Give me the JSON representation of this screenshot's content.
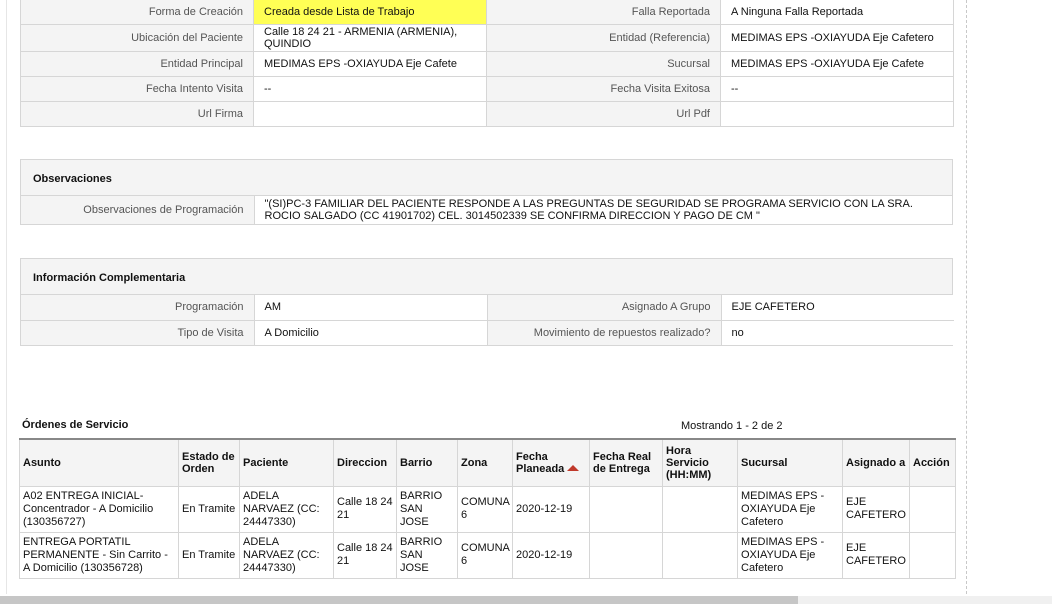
{
  "top_fields": {
    "rows": [
      {
        "l1": "Forma de Creación",
        "v1": "Creada desde Lista de Trabajo",
        "l2": "Falla Reportada",
        "v2": "A Ninguna Falla Reportada"
      },
      {
        "l1": "Ubicación del Paciente",
        "v1": "Calle 18 24 21 - ARMENIA (ARMENIA), QUINDIO",
        "l2": "Entidad (Referencia)",
        "v2": "MEDIMAS EPS -OXIAYUDA Eje Cafetero"
      },
      {
        "l1": "Entidad Principal",
        "v1": "MEDIMAS EPS -OXIAYUDA Eje Cafete",
        "l2": "Sucursal",
        "v2": "MEDIMAS EPS -OXIAYUDA Eje Cafete"
      },
      {
        "l1": "Fecha Intento Visita",
        "v1": "--",
        "l2": "Fecha Visita Exitosa",
        "v2": "--"
      },
      {
        "l1": "Url Firma",
        "v1": "",
        "l2": "Url Pdf",
        "v2": ""
      }
    ]
  },
  "observaciones": {
    "title": "Observaciones",
    "label": "Observaciones de Programación",
    "value": "\"(SI)PC-3 FAMILIAR DEL PACIENTE RESPONDE A LAS PREGUNTAS DE SEGURIDAD SE PROGRAMA SERVICIO CON LA SRA. ROCIO SALGADO (CC 41901702) CEL. 3014502339 SE CONFIRMA DIRECCION Y PAGO DE CM \""
  },
  "info_complementaria": {
    "title": "Información Complementaria",
    "rows": [
      {
        "l1": "Programación",
        "v1": "AM",
        "l2": "Asignado A Grupo",
        "v2": "EJE CAFETERO"
      },
      {
        "l1": "Tipo de Visita",
        "v1": "A Domicilio",
        "l2": "Movimiento de repuestos realizado?",
        "v2": "no"
      }
    ]
  },
  "orders": {
    "title": "Órdenes de Servicio",
    "count_text": "Mostrando 1 - 2 de 2",
    "columns": [
      "Asunto",
      "Estado de Orden",
      "Paciente",
      "Direccion",
      "Barrio",
      "Zona",
      "Fecha Planeada",
      "Fecha Real de Entrega",
      "Hora Servicio (HH:MM)",
      "Sucursal",
      "Asignado a",
      "Acción"
    ],
    "rows": [
      {
        "asunto": "A02 ENTREGA INICIAL-Concentrador - A Domicilio (130356727)",
        "estado": "En Tramite",
        "paciente": "ADELA NARVAEZ (CC: 24447330)",
        "direccion": "Calle 18 24 21",
        "barrio": "BARRIO SAN JOSE",
        "zona": "COMUNA 6",
        "fecha_planeada": "2020-12-19",
        "fecha_real": "",
        "hora": "",
        "sucursal": "MEDIMAS EPS -OXIAYUDA Eje Cafetero",
        "asignado": "EJE CAFETERO",
        "accion": ""
      },
      {
        "asunto": "ENTREGA PORTATIL PERMANENTE - Sin Carrito - A Domicilio (130356728)",
        "estado": "En Tramite",
        "paciente": "ADELA NARVAEZ (CC: 24447330)",
        "direccion": "Calle 18 24 21",
        "barrio": "BARRIO SAN JOSE",
        "zona": "COMUNA 6",
        "fecha_planeada": "2020-12-19",
        "fecha_real": "",
        "hora": "",
        "sucursal": "MEDIMAS EPS -OXIAYUDA Eje Cafetero",
        "asignado": "EJE CAFETERO",
        "accion": ""
      }
    ]
  },
  "colors": {
    "highlight": "#ffff55",
    "sort_arrow": "#c0392b"
  },
  "icons": {
    "sort": "sort-ascending-icon"
  }
}
